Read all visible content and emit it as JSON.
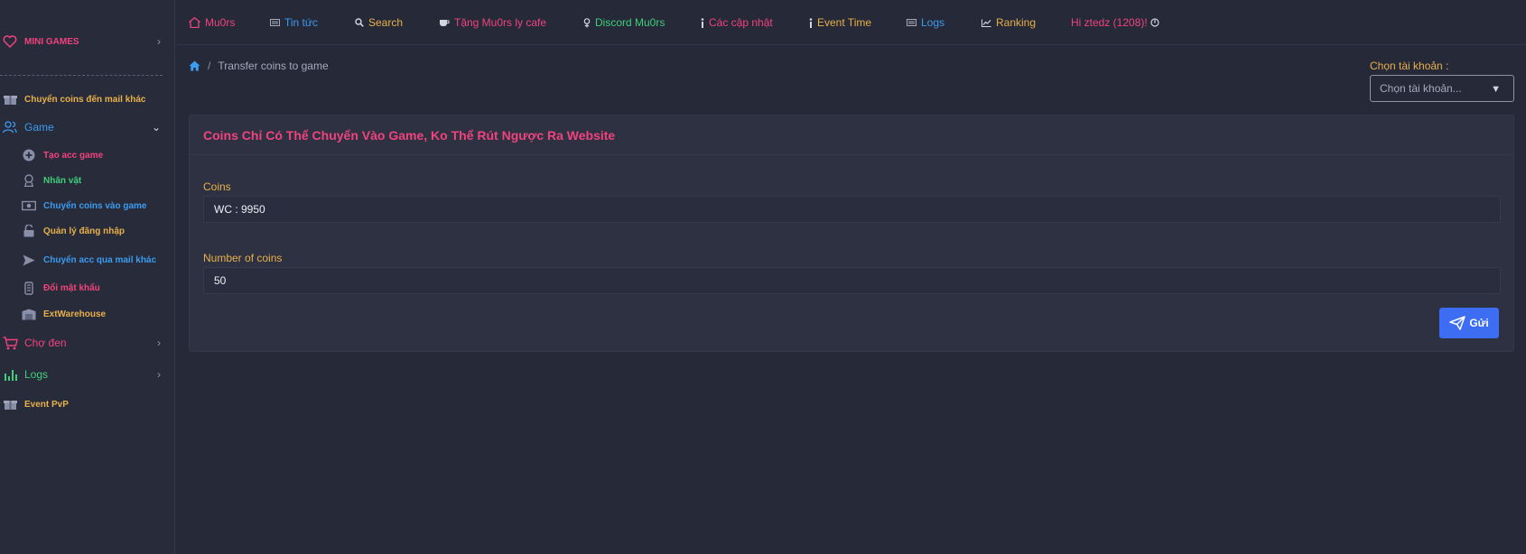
{
  "sidebar": {
    "mini_games": "MINI GAMES",
    "transfer_mail": "Chuyển coins đến mail khác",
    "game": "Game",
    "game_items": [
      {
        "label": "Tạo acc game",
        "color": "#f0437e",
        "icon": "plus-circle-icon"
      },
      {
        "label": "Nhân vật",
        "color": "#3ecf7a",
        "icon": "character-icon"
      },
      {
        "label": "Chuyển coins vào game",
        "color": "#3b9cf0",
        "icon": "money-icon"
      },
      {
        "label": "Quản lý đăng nhập",
        "color": "#e8b04a",
        "icon": "unlock-icon"
      },
      {
        "label": "Chuyển acc qua mail khác",
        "color": "#3b9cf0",
        "icon": "send-icon"
      },
      {
        "label": "Đổi mật khẩu",
        "color": "#f0437e",
        "icon": "key-icon"
      },
      {
        "label": "ExtWarehouse",
        "color": "#e8b04a",
        "icon": "warehouse-icon"
      }
    ],
    "black_market": "Chợ đen",
    "logs": "Logs",
    "event_pvp": "Event PvP"
  },
  "topnav": [
    {
      "label": "Mu0rs",
      "color": "#f0437e",
      "icon": "home-icon"
    },
    {
      "label": "Tin tức",
      "color": "#3b9cf0",
      "icon": "news-icon"
    },
    {
      "label": "Search",
      "color": "#e8b04a",
      "icon": "search-icon"
    },
    {
      "label": "Tặng Mu0rs ly cafe",
      "color": "#f0437e",
      "icon": "coffee-icon"
    },
    {
      "label": "Discord Mu0rs",
      "color": "#3ecf7a",
      "icon": "discord-icon"
    },
    {
      "label": "Các cập nhật",
      "color": "#f0437e",
      "icon": "info-icon"
    },
    {
      "label": "Event Time",
      "color": "#e8b04a",
      "icon": "info-icon"
    },
    {
      "label": "Logs",
      "color": "#3b9cf0",
      "icon": "logs-icon"
    },
    {
      "label": "Ranking",
      "color": "#e8b04a",
      "icon": "chart-icon"
    },
    {
      "label": "Hi ztedz (1208)!",
      "color": "#f0437e",
      "icon": "power-icon"
    }
  ],
  "breadcrumb": {
    "current": "Transfer coins to game"
  },
  "account": {
    "label": "Chọn tài khoản :",
    "placeholder": "Chọn tài khoản..."
  },
  "card": {
    "title": "Coins Chỉ Có Thể Chuyển Vào Game, Ko Thể Rút Ngược Ra Website",
    "coins_label": "Coins",
    "coins_value": "WC : 9950",
    "number_label": "Number of coins",
    "number_value": "50",
    "send_label": "Gửi"
  },
  "colors": {
    "pink": "#f0437e",
    "yellow": "#e8b04a",
    "blue": "#3b9cf0",
    "green": "#3ecf7a",
    "button": "#3d6df2"
  }
}
